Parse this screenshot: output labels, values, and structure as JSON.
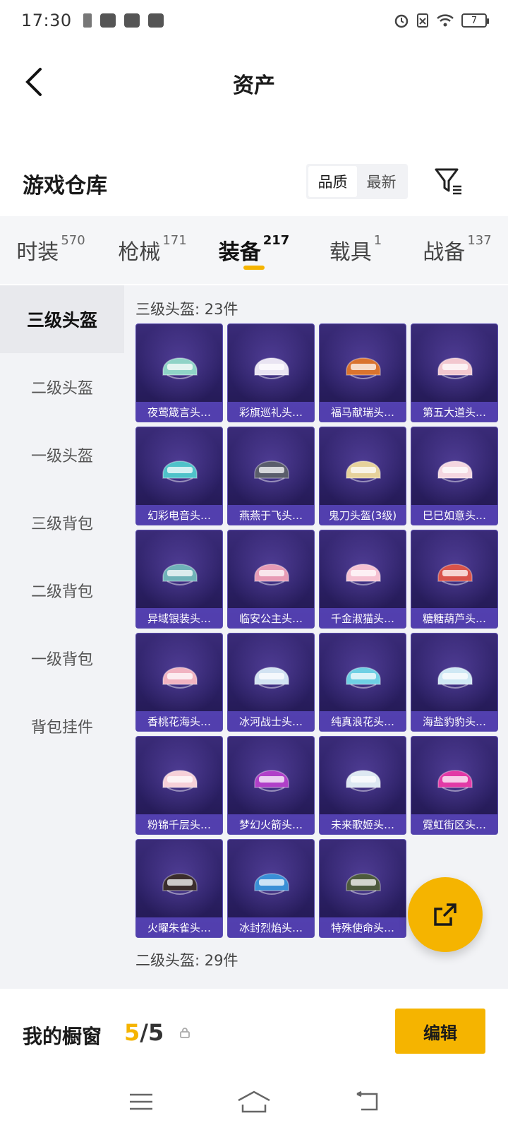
{
  "status_bar": {
    "time": "17:30",
    "battery": "7"
  },
  "header": {
    "title": "资产"
  },
  "warehouse": {
    "title": "游戏仓库",
    "sort_options": [
      "品质",
      "最新"
    ],
    "sort_active": "品质"
  },
  "categories": [
    {
      "label": "时装",
      "count": "570",
      "active": false
    },
    {
      "label": "枪械",
      "count": "171",
      "active": false
    },
    {
      "label": "装备",
      "count": "217",
      "active": true
    },
    {
      "label": "载具",
      "count": "1",
      "active": false
    },
    {
      "label": "战备",
      "count": "137",
      "active": false
    }
  ],
  "sidebar": {
    "items": [
      "三级头盔",
      "二级头盔",
      "一级头盔",
      "三级背包",
      "二级背包",
      "一级背包",
      "背包挂件"
    ],
    "active_index": 0
  },
  "content": {
    "section1_title": "三级头盔: 23件",
    "section2_title": "二级头盔: 29件",
    "items": [
      {
        "name": "夜莺箴言头…",
        "color": "#8fd3c7"
      },
      {
        "name": "彩旗巡礼头…",
        "color": "#e9e4f2"
      },
      {
        "name": "福马献瑞头…",
        "color": "#d9732e"
      },
      {
        "name": "第五大道头…",
        "color": "#f2c7cf"
      },
      {
        "name": "幻彩电音头…",
        "color": "#4fc2c9"
      },
      {
        "name": "燕燕于飞头…",
        "color": "#5a5d6b"
      },
      {
        "name": "鬼刀头盔(3级)",
        "color": "#e6d29b"
      },
      {
        "name": "巳巳如意头…",
        "color": "#f4d6e0"
      },
      {
        "name": "异域银装头…",
        "color": "#6fb2b8"
      },
      {
        "name": "临安公主头…",
        "color": "#e79bb5"
      },
      {
        "name": "千金淑猫头…",
        "color": "#f5c2d2"
      },
      {
        "name": "糖糖葫芦头…",
        "color": "#d9534a"
      },
      {
        "name": "香桃花海头…",
        "color": "#f1b3c1"
      },
      {
        "name": "冰河战士头…",
        "color": "#d2e3f2"
      },
      {
        "name": "纯真浪花头…",
        "color": "#6fd0e4"
      },
      {
        "name": "海盐豹豹头…",
        "color": "#cfe8f4"
      },
      {
        "name": "粉锦千层头…",
        "color": "#f6d0d8"
      },
      {
        "name": "梦幻火箭头…",
        "color": "#b040c8"
      },
      {
        "name": "未来歌姬头…",
        "color": "#dde8f2"
      },
      {
        "name": "霓虹街区头…",
        "color": "#e23aa6"
      },
      {
        "name": "火曜朱雀头…",
        "color": "#3b2d2d"
      },
      {
        "name": "冰封烈焰头…",
        "color": "#3a8fd6"
      },
      {
        "name": "特殊使命头…",
        "color": "#4d5a3d"
      }
    ]
  },
  "showcase": {
    "label": "我的橱窗",
    "current": "5",
    "separator": "/",
    "max": "5",
    "edit_label": "编辑"
  },
  "colors": {
    "accent": "#f5b400",
    "card_bg": "#2f2470",
    "card_label_bg": "#5a46be"
  }
}
